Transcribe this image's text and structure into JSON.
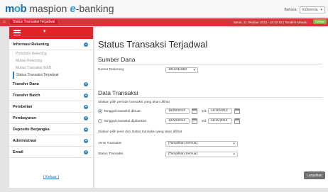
{
  "app": {
    "logo_main": "m",
    "logo_o": "o",
    "logo_b": "b",
    "logo_text": "maspion",
    "logo_e": "e",
    "logo_suffix": "-banking",
    "lang_label": "Bahasa:",
    "lang_value": "Indonesia"
  },
  "nav": {
    "home_icon": "home-icon",
    "breadcrumb": "Status Transaksi Terjadwal",
    "datetime": "Senin, 11 Oktober 2012 - 10:22:33 | Terakhir Masuk: ...",
    "logout_label": "Keluar"
  },
  "sidebar": {
    "sections": [
      {
        "label": "Informasi Rekening",
        "items": [
          "Portofolio Rekening",
          "Mutasi Rekening",
          "Mutasi Transaksi WEB",
          "Status Transaksi Terjadwal"
        ]
      },
      {
        "label": "Transfer Dana"
      },
      {
        "label": "Transfer Batch"
      },
      {
        "label": "Pembelian"
      },
      {
        "label": "Pembayaran"
      },
      {
        "label": "Deposito Berjangka"
      },
      {
        "label": "Administrasi"
      },
      {
        "label": "Email"
      }
    ],
    "keluar": "[ Keluar ]"
  },
  "main": {
    "title": "Status Transaksi Terjadwal",
    "sumber_dana": {
      "heading": "Sumber Dana",
      "nomor_label": "Nomor Rekening",
      "nomor_value": "1011011884"
    },
    "data_transaksi": {
      "heading": "Data Transaksi",
      "periode_prompt": "Silakan pilih periode transaksi yang akan dilihat",
      "opt1_label": "Tanggal transaksi dibuat",
      "opt1_from": "19/09/2012",
      "opt1_sd": "s/d",
      "opt1_to": "11/10/2012",
      "opt2_label": "Tanggal transaksi dijalankan",
      "opt2_from": "12/10/2012",
      "opt2_sd": "s/d",
      "opt2_to": "11/11/2012",
      "jenis_prompt": "Silakan pilih jenis dan status transaksi yang akan dilihat",
      "jenis_label": "Jenis Transaksi",
      "jenis_value": "[Tampilkan Semua]",
      "status_label": "Status Transaksi",
      "status_value": "[Tampilkan Semua]"
    },
    "next_button": "Lanjutkan"
  }
}
